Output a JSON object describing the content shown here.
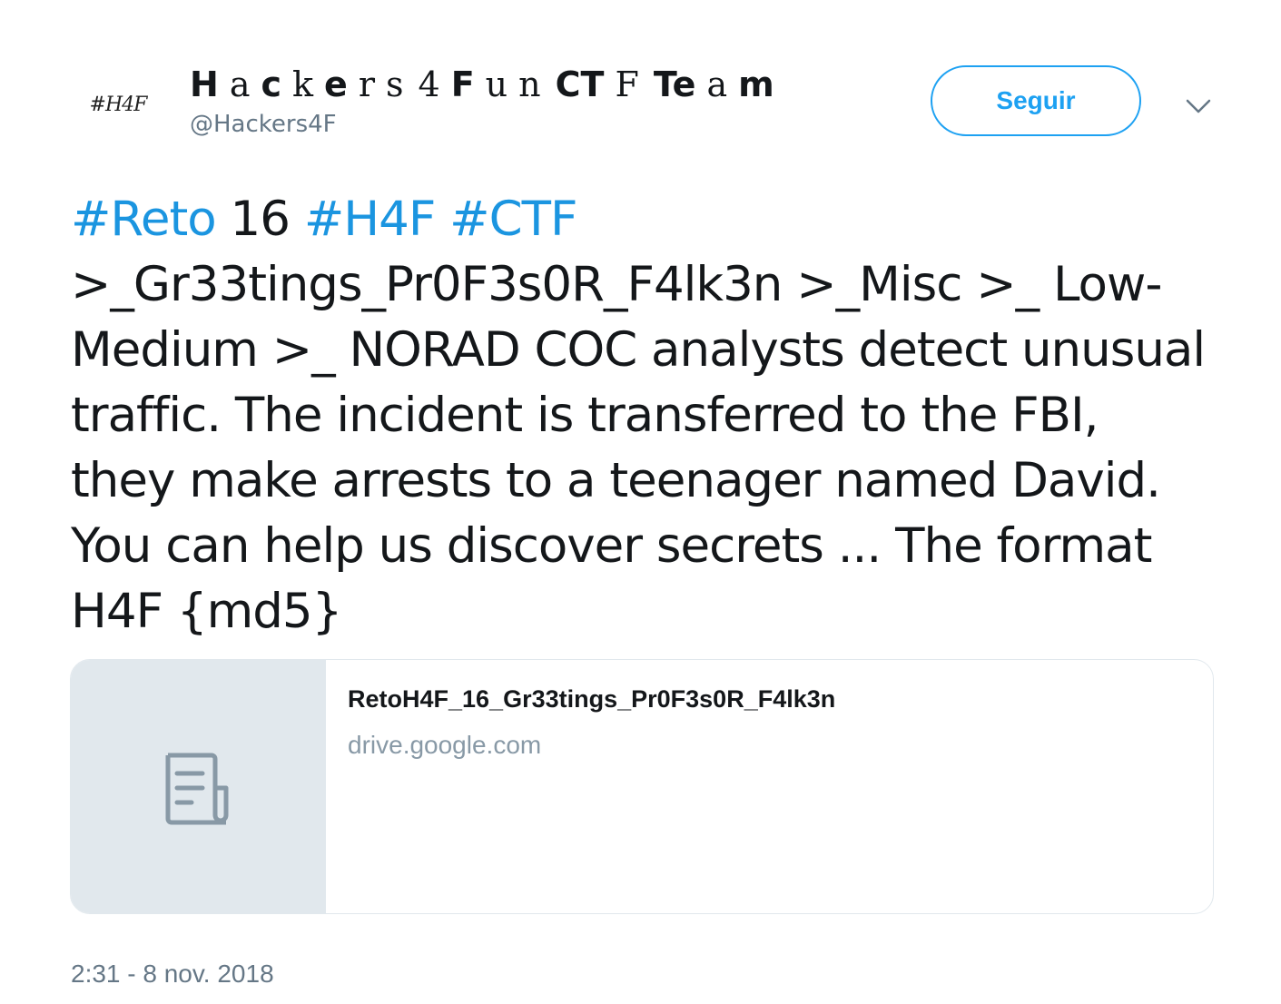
{
  "header": {
    "avatar_text": "#H4F",
    "display_name_parts": [
      "H",
      "a",
      "c",
      "k",
      "e",
      "r",
      "s",
      "4",
      "F",
      "u",
      "n",
      "CT",
      "F",
      "Te",
      "a",
      "m"
    ],
    "handle": "@Hackers4F",
    "follow_label": "Seguir",
    "menu_icon": "chevron-down-icon"
  },
  "tweet": {
    "hashtag_reto": "#Reto",
    "number": "16",
    "hashtag_h4f": "#H4F",
    "hashtag_ctf": "#CTF",
    "body": ">_Gr33tings_Pr0F3s0R_F4lk3n >_Misc >_ Low-Medium >_ NORAD COC analysts detect unusual traffic. The incident is transferred to the FBI, they make arrests to a teenager named David. You can help us discover secrets ... The format H4F {md5}"
  },
  "card": {
    "icon": "document-icon",
    "title": "RetoH4F_16_Gr33tings_Pr0F3s0R_F4lk3n",
    "domain": "drive.google.com"
  },
  "timestamp": "2:31 - 8 nov. 2018",
  "colors": {
    "accent": "#1da1f2",
    "hashtag": "#1b95e0",
    "muted": "#657786",
    "card_thumb_bg": "#e1e8ed"
  }
}
